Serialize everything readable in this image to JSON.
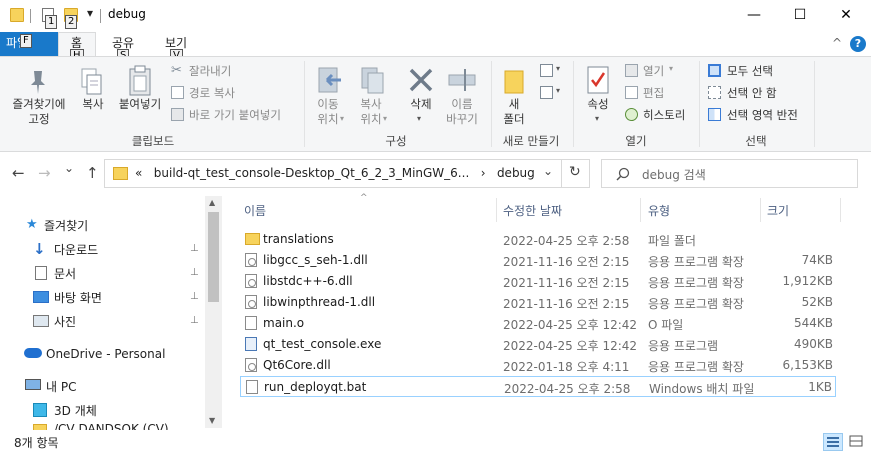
{
  "titlebar": {
    "title": "debug",
    "keytips": [
      "1",
      "2"
    ],
    "dropdown": "▾",
    "minimize": "—",
    "maximize": "☐",
    "close": "✕"
  },
  "tabs": {
    "file": "파일",
    "file_keytip": "F",
    "home": "홈",
    "home_keytip": "H",
    "share": "공유",
    "share_keytip": "S",
    "view": "보기",
    "view_keytip": "V",
    "collapse": "^",
    "help": "?"
  },
  "ribbon": {
    "clipboard": {
      "pin_quick": "즐겨찾기에\n고정",
      "copy": "복사",
      "paste": "붙여넣기",
      "cut": "잘라내기",
      "copy_path": "경로 복사",
      "paste_shortcut": "바로 가기 붙여넣기",
      "group": "클립보드"
    },
    "organize": {
      "move_to": "이동\n위치",
      "copy_to": "복사\n위치",
      "delete": "삭제",
      "rename": "이름\n바꾸기",
      "group": "구성"
    },
    "new": {
      "new_folder": "새\n폴더",
      "group": "새로 만들기"
    },
    "open": {
      "properties": "속성",
      "open": "열기",
      "edit": "편집",
      "history": "히스토리",
      "group": "열기"
    },
    "select": {
      "select_all": "모두 선택",
      "select_none": "선택 안 함",
      "invert": "선택 영역 반전",
      "group": "선택"
    }
  },
  "nav": {
    "back": "←",
    "forward": "→",
    "recent": "⌄",
    "up": "↑",
    "address_text": "«   build-qt_test_console-Desktop_Qt_6_2_3_MinGW_6...   ›   debug",
    "address_dropdown": "⌄",
    "refresh": "↻",
    "search_placeholder": "debug 검색"
  },
  "navpane": {
    "items": [
      {
        "label": "즐겨찾기",
        "pinned": false
      },
      {
        "label": "다운로드",
        "pinned": true
      },
      {
        "label": "문서",
        "pinned": true
      },
      {
        "label": "바탕 화면",
        "pinned": true
      },
      {
        "label": "사진",
        "pinned": true
      },
      {
        "label": "OneDrive - Personal",
        "pinned": false
      },
      {
        "label": "내 PC",
        "pinned": false
      },
      {
        "label": "3D 개체",
        "pinned": false
      },
      {
        "label": "/CV DANDSOK (CV)",
        "pinned": false
      }
    ],
    "pin_glyph": "📌"
  },
  "columns": {
    "name": "이름",
    "modified": "수정한 날짜",
    "type": "유형",
    "size": "크기"
  },
  "files": [
    {
      "name": "translations",
      "modified": "2022-04-25 오후 2:58",
      "type": "파일 폴더",
      "size": "",
      "kind": "folder"
    },
    {
      "name": "libgcc_s_seh-1.dll",
      "modified": "2021-11-16 오전 2:15",
      "type": "응용 프로그램 확장",
      "size": "74KB",
      "kind": "dll"
    },
    {
      "name": "libstdc++-6.dll",
      "modified": "2021-11-16 오전 2:15",
      "type": "응용 프로그램 확장",
      "size": "1,912KB",
      "kind": "dll"
    },
    {
      "name": "libwinpthread-1.dll",
      "modified": "2021-11-16 오전 2:15",
      "type": "응용 프로그램 확장",
      "size": "52KB",
      "kind": "dll"
    },
    {
      "name": "main.o",
      "modified": "2022-04-25 오후 12:42",
      "type": "O 파일",
      "size": "544KB",
      "kind": "file"
    },
    {
      "name": "qt_test_console.exe",
      "modified": "2022-04-25 오후 12:42",
      "type": "응용 프로그램",
      "size": "490KB",
      "kind": "exe"
    },
    {
      "name": "Qt6Core.dll",
      "modified": "2022-01-18 오후 4:11",
      "type": "응용 프로그램 확장",
      "size": "6,153KB",
      "kind": "dll"
    },
    {
      "name": "run_deployqt.bat",
      "modified": "2022-04-25 오후 2:58",
      "type": "Windows 배치 파일",
      "size": "1KB",
      "kind": "bat"
    }
  ],
  "status": {
    "count": "8개 항목"
  },
  "colors": {
    "accent": "#1979ca",
    "folder": "#f7d35c",
    "selection_border": "#99d1ff"
  }
}
